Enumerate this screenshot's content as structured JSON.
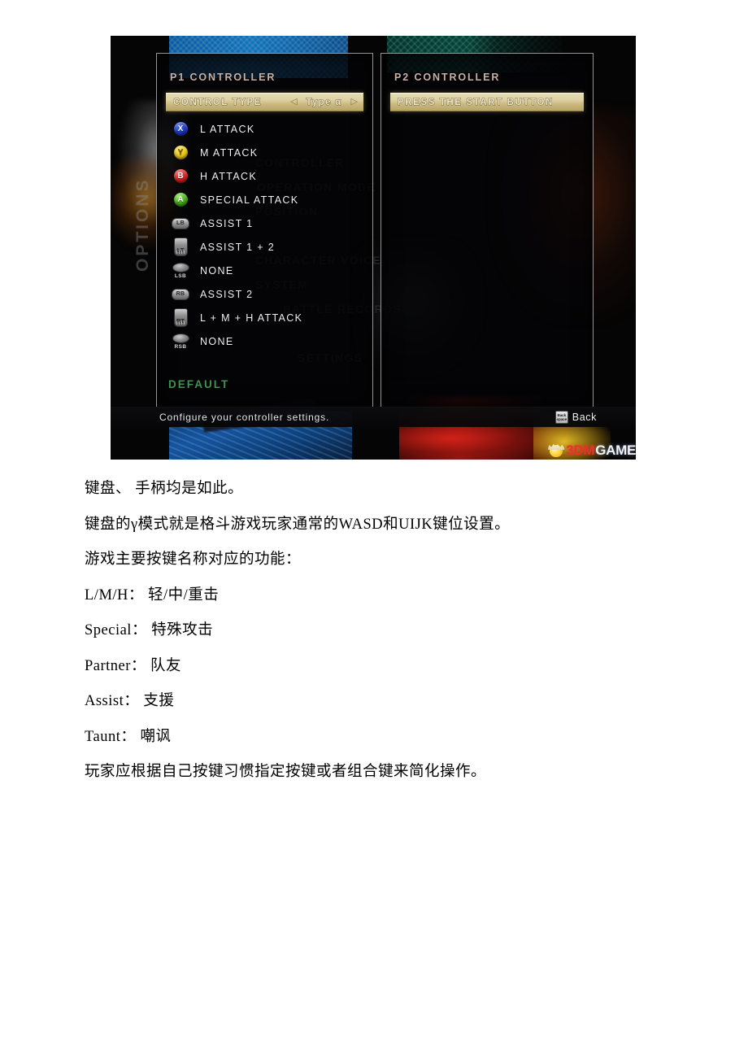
{
  "screenshot": {
    "p1_panel": {
      "title": "P1 CONTROLLER",
      "highlight_row": {
        "label": "CONTROL TYPE",
        "left_arrow": "◁",
        "value": "Type α",
        "right_arrow": "▷"
      },
      "bindings": [
        {
          "icon": "xbox-x-button-icon",
          "key": "X",
          "action": "L ATTACK"
        },
        {
          "icon": "xbox-y-button-icon",
          "key": "Y",
          "action": "M ATTACK"
        },
        {
          "icon": "xbox-b-button-icon",
          "key": "B",
          "action": "H ATTACK"
        },
        {
          "icon": "xbox-a-button-icon",
          "key": "A",
          "action": "SPECIAL ATTACK"
        },
        {
          "icon": "xbox-lb-bumper-icon",
          "key": "LB",
          "action": "ASSIST 1"
        },
        {
          "icon": "xbox-lt-trigger-icon",
          "key": "LT",
          "action": "ASSIST 1 + 2"
        },
        {
          "icon": "xbox-lsb-stick-icon",
          "key": "LSB",
          "action": "NONE"
        },
        {
          "icon": "xbox-rb-bumper-icon",
          "key": "RB",
          "action": "ASSIST 2"
        },
        {
          "icon": "xbox-rt-trigger-icon",
          "key": "RT",
          "action": "L + M + H ATTACK"
        },
        {
          "icon": "xbox-rsb-stick-icon",
          "key": "RSB",
          "action": "NONE"
        }
      ],
      "default_button": "DEFAULT"
    },
    "p2_panel": {
      "title": "P2 CONTROLLER",
      "prompt": "PRESS THE START BUTTON"
    },
    "ghost_menu": [
      "CONTROLLER",
      "OPERATION MODE",
      "POSITION",
      "CHARACTER VOICE",
      "SYSTEM",
      "BATTLE RECORDS",
      "SETTINGS"
    ],
    "options_label": "OPTIONS",
    "bottom_bar": {
      "hint": "Configure your controller settings.",
      "back_key_line1": "Back",
      "back_key_line2": "space",
      "back_label": "Back"
    },
    "watermark": {
      "part1": "3DM",
      "part2": "GAME",
      "color1": "#e8332a",
      "color2": "#f2f2f2"
    }
  },
  "document": {
    "lines": [
      "键盘、 手柄均是如此。",
      "键盘的γ模式就是格斗游戏玩家通常的WASD和UIJK键位设置。",
      "游戏主要按键名称对应的功能：",
      "L/M/H： 轻/中/重击",
      "Special： 特殊攻击",
      "Partner： 队友",
      "Assist： 支援",
      "Taunt： 嘲讽",
      "玩家应根据自己按键习惯指定按键或者组合键来简化操作。"
    ]
  }
}
